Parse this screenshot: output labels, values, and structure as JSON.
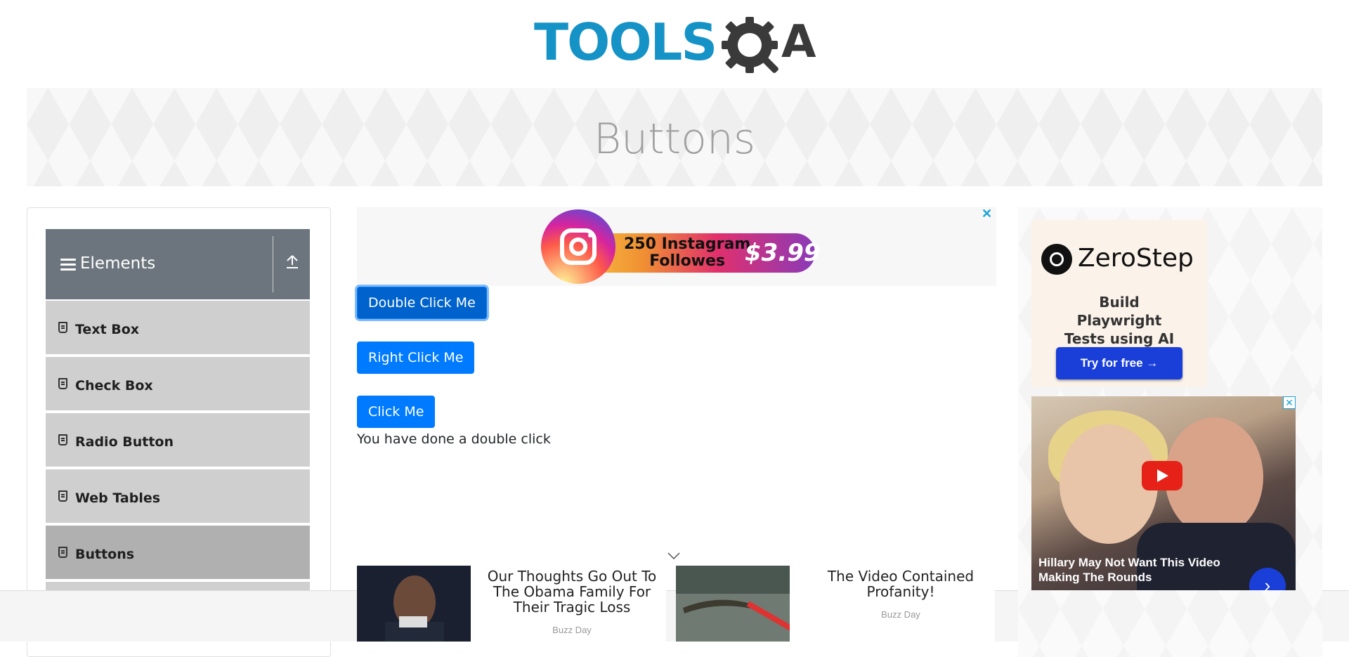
{
  "header": {
    "logo_text": "TOOLS",
    "logo_suffix": "A",
    "banner_title": "Buttons"
  },
  "sidebar": {
    "group_title": "Elements",
    "items": [
      {
        "label": "Text Box"
      },
      {
        "label": "Check Box"
      },
      {
        "label": "Radio Button"
      },
      {
        "label": "Web Tables"
      },
      {
        "label": "Buttons",
        "active": true
      }
    ]
  },
  "top_ad": {
    "line1": "250 Instagram",
    "line2": "Followes",
    "price": "$3.99",
    "close": "✕"
  },
  "buttons": {
    "double_click": "Double Click Me",
    "right_click": "Right Click Me",
    "click": "Click Me"
  },
  "result_message": "You have done a double click",
  "news": [
    {
      "title": "Our Thoughts Go Out To The Obama Family For Their Tragic Loss",
      "source": "Buzz Day"
    },
    {
      "title": "The Video Contained Profanity!",
      "source": "Buzz Day"
    }
  ],
  "right_ads": {
    "zerostep_name": "ZeroStep",
    "zerostep_tagline": "Build Playwright Tests using AI",
    "zerostep_cta": "Try for free →",
    "video_caption": "Hillary May Not Want This Video Making The Rounds",
    "video_close": "✕",
    "video_next": "›"
  },
  "colors": {
    "primary_button": "#007bff",
    "logo_blue": "#1592c6",
    "sidebar_header": "#6c757d"
  }
}
